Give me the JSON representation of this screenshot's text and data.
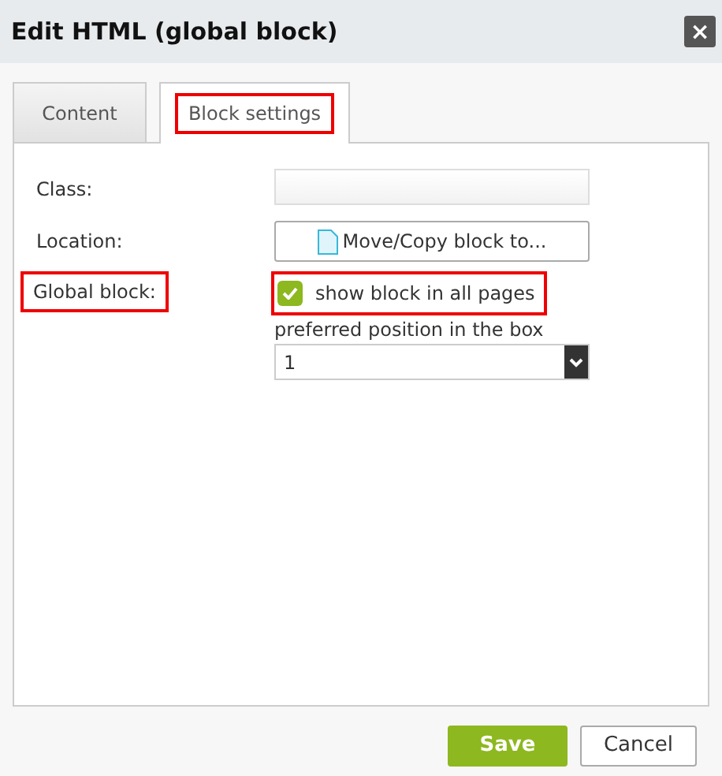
{
  "window": {
    "title": "Edit HTML (global block)",
    "close": "×"
  },
  "tabs": [
    {
      "label": "Content",
      "selected": false,
      "highlighted": false
    },
    {
      "label": "Block settings",
      "selected": true,
      "highlighted": true
    }
  ],
  "form": {
    "class": {
      "label": "Class:"
    },
    "location": {
      "label": "Location:",
      "button": "Move/Copy block to..."
    },
    "global": {
      "label": "Global block:",
      "label_highlighted": true,
      "checkbox": "show block in all pages",
      "checked": true,
      "checkbox_highlighted": true,
      "position_label": "preferred position in the box",
      "position_value": "1"
    }
  },
  "buttons": [
    {
      "label": "Save",
      "kind": "primary"
    },
    {
      "label": "Cancel",
      "kind": "secondary"
    }
  ]
}
